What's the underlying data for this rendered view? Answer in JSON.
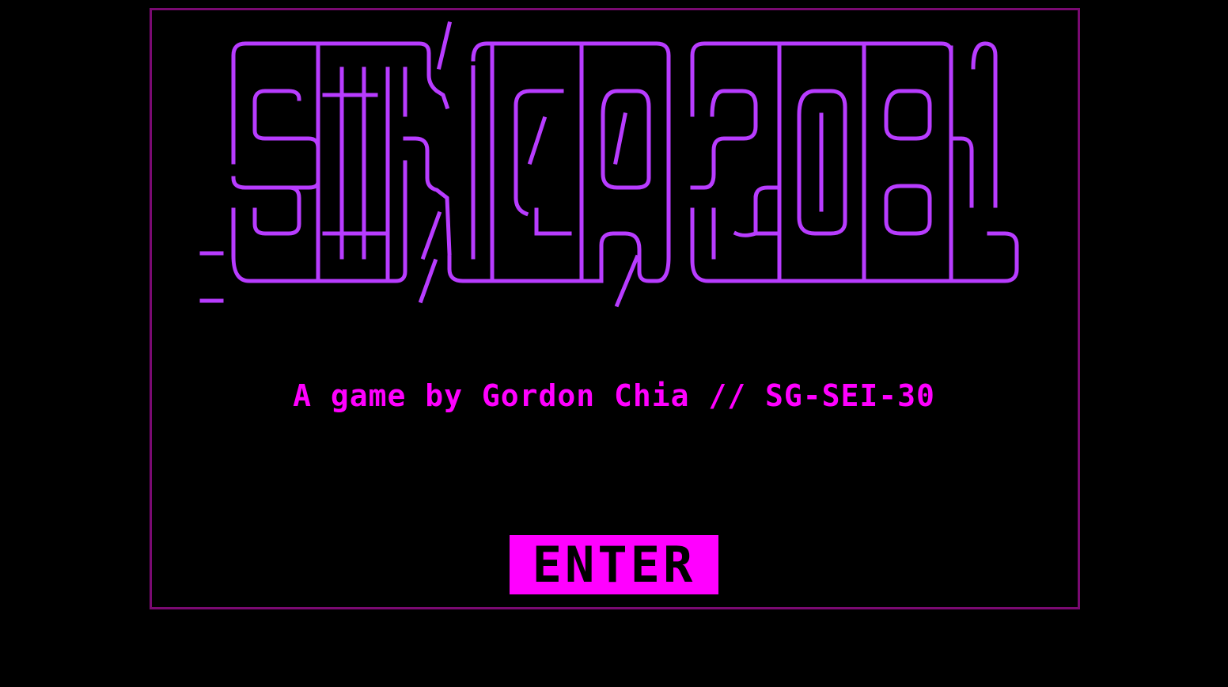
{
  "logo": {
    "text": "SINGA2081",
    "color": "#b83cff"
  },
  "subtitle": "A game by Gordon Chia // SG-SEI-30",
  "enter_button": {
    "label": "ENTER",
    "background": "#ff00ff",
    "text_color": "#000000"
  },
  "colors": {
    "background": "#000000",
    "frame": "#7a0a72",
    "accent": "#ff00ff"
  }
}
